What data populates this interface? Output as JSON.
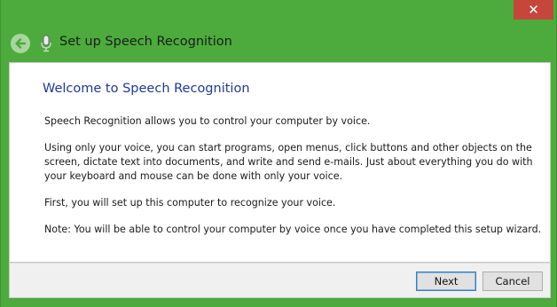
{
  "window": {
    "close_glyph": "✕",
    "accent_color": "#4cab3c",
    "close_color": "#c7463c"
  },
  "header": {
    "back_icon": "back-arrow-icon",
    "app_icon": "microphone-icon",
    "title": "Set up Speech Recognition"
  },
  "main": {
    "heading": "Welcome to Speech Recognition",
    "paragraphs": [
      "Speech Recognition allows you to control your computer by voice.",
      "Using only your voice, you can start programs, open menus, click buttons and other objects on the screen, dictate text into documents, and write and send e-mails. Just about everything you do with your keyboard and mouse can be done with only your voice.",
      "First, you will set up this computer to recognize your voice.",
      "Note: You will be able to control your computer by voice once you have completed this setup wizard."
    ],
    "heading_color": "#1e3a96"
  },
  "footer": {
    "next_label": "Next",
    "cancel_label": "Cancel"
  }
}
